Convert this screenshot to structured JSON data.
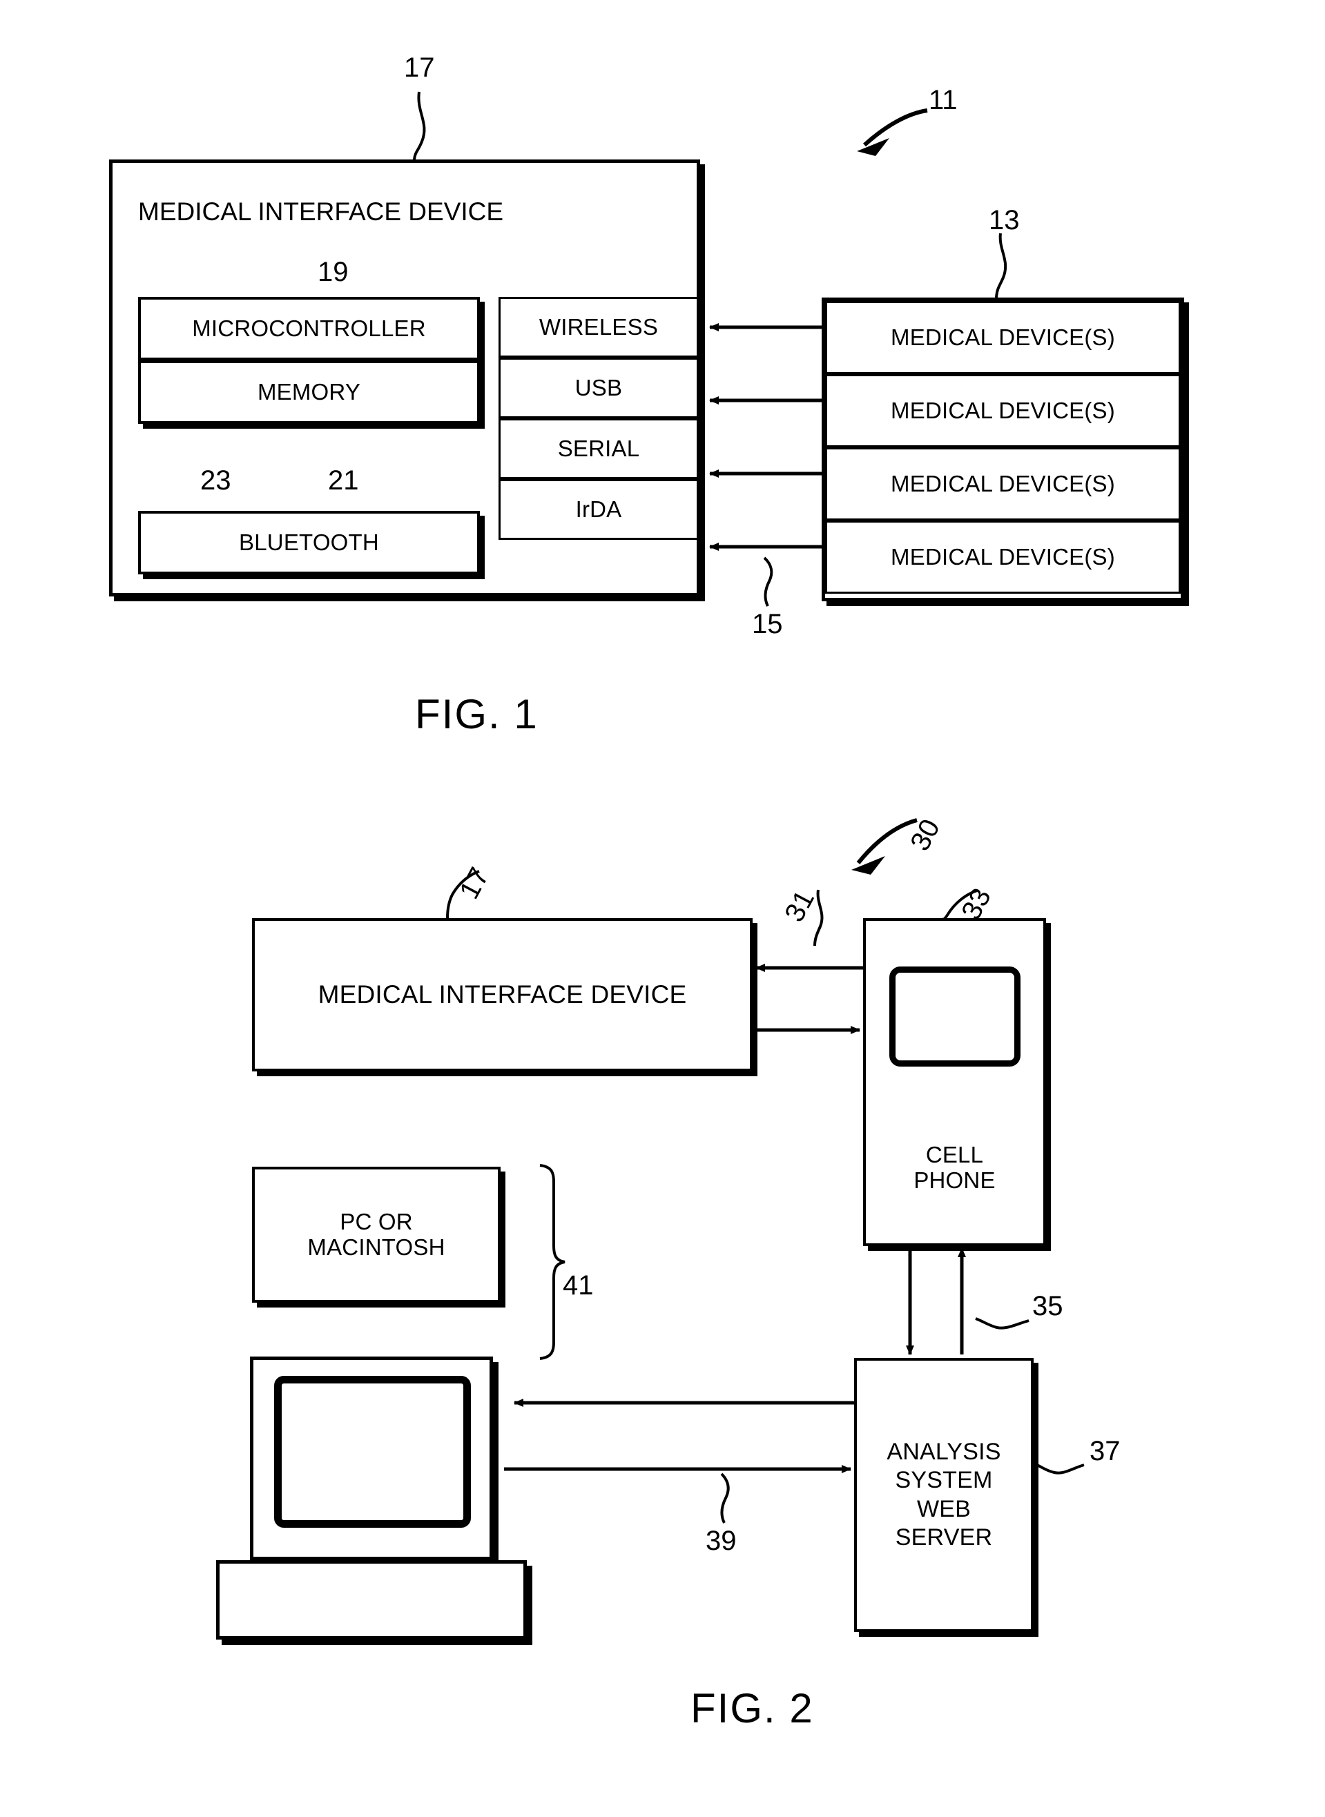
{
  "figures": [
    {
      "caption": "FIG. 1",
      "system_ref": "11",
      "blocks": {
        "interface_device": {
          "label": "MEDICAL INTERFACE DEVICE",
          "ref": "17"
        },
        "microcontroller": {
          "label": "MICROCONTROLLER",
          "ref": "19"
        },
        "memory": {
          "label": "MEMORY",
          "ref": "21"
        },
        "bluetooth": {
          "label": "BLUETOOTH",
          "ref": "23"
        },
        "ports": [
          {
            "label": "WIRELESS"
          },
          {
            "label": "USB"
          },
          {
            "label": "SERIAL"
          },
          {
            "label": "IrDA"
          }
        ],
        "ports_ref": "15",
        "medical_devices": {
          "ref": "13",
          "items": [
            "MEDICAL DEVICE(S)",
            "MEDICAL DEVICE(S)",
            "MEDICAL DEVICE(S)",
            "MEDICAL DEVICE(S)"
          ]
        }
      }
    },
    {
      "caption": "FIG. 2",
      "system_ref": "30",
      "blocks": {
        "interface_device": {
          "label": "MEDICAL INTERFACE DEVICE",
          "ref": "17"
        },
        "cell_phone": {
          "label": "CELL\nPHONE",
          "ref": "33"
        },
        "link_phone_to_device_ref": "31",
        "pc_or_mac": {
          "label": "PC OR\nMACINTOSH",
          "ref": "41"
        },
        "computer_illustration": {
          "label": ""
        },
        "analysis_server": {
          "label": "ANALYSIS\nSYSTEM\nWEB\nSERVER",
          "ref": "37"
        },
        "link_phone_to_server_ref": "35",
        "link_computer_to_server_ref": "39"
      }
    }
  ],
  "colors": {
    "ink": "#000000",
    "paper": "#ffffff"
  }
}
